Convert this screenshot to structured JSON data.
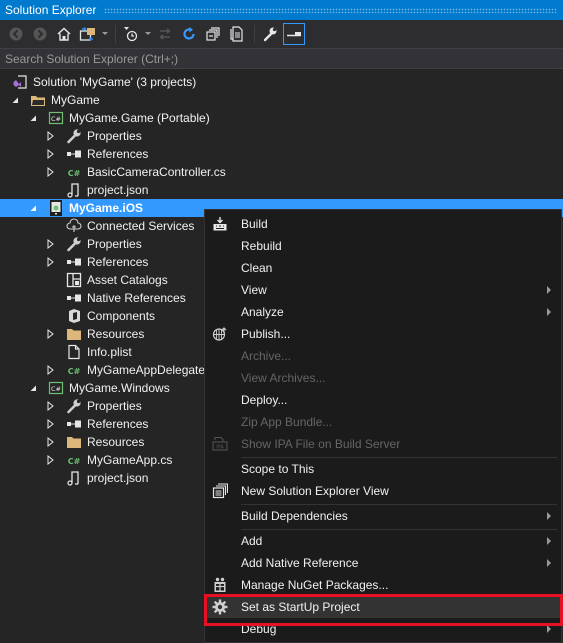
{
  "window": {
    "title": "Solution Explorer"
  },
  "toolbar": {
    "buttons": [
      {
        "name": "back-button",
        "icon": "back-arrow-icon",
        "enabled": false
      },
      {
        "name": "forward-button",
        "icon": "forward-arrow-icon",
        "enabled": false
      },
      {
        "name": "home-button",
        "icon": "home-icon",
        "enabled": true
      },
      {
        "name": "switch-views-button",
        "icon": "switch-views-icon",
        "enabled": true,
        "dropdown": true
      },
      {
        "name": "pending-changes-filter-button",
        "icon": "clock-filter-icon",
        "enabled": true,
        "dropdown": true
      },
      {
        "name": "sync-active-document-button",
        "icon": "sync-icon",
        "enabled": false
      },
      {
        "name": "refresh-button",
        "icon": "refresh-icon",
        "enabled": true
      },
      {
        "name": "collapse-all-button",
        "icon": "collapse-all-icon",
        "enabled": true
      },
      {
        "name": "show-all-files-button",
        "icon": "show-all-files-icon",
        "enabled": true
      },
      {
        "name": "properties-button",
        "icon": "wrench-icon",
        "enabled": true
      },
      {
        "name": "preview-selected-items-button",
        "icon": "preview-icon",
        "enabled": true,
        "active": true
      }
    ]
  },
  "search": {
    "placeholder": "Search Solution Explorer (Ctrl+;)",
    "value": ""
  },
  "tree": {
    "items": [
      {
        "label": "Solution 'MyGame' (3 projects)",
        "icon": "solution-icon",
        "level": 0,
        "expander": "none"
      },
      {
        "label": "MyGame",
        "icon": "solution-folder-icon",
        "level": 0,
        "expander": "expanded"
      },
      {
        "label": "MyGame.Game (Portable)",
        "icon": "csharp-project-icon",
        "level": 1,
        "expander": "expanded"
      },
      {
        "label": "Properties",
        "icon": "wrench-icon",
        "level": 2,
        "expander": "collapsed"
      },
      {
        "label": "References",
        "icon": "references-icon",
        "level": 2,
        "expander": "collapsed"
      },
      {
        "label": "BasicCameraController.cs",
        "icon": "csharp-file-icon",
        "level": 2,
        "expander": "collapsed"
      },
      {
        "label": "project.json",
        "icon": "json-file-icon",
        "level": 2,
        "expander": "none"
      },
      {
        "label": "MyGame.iOS",
        "icon": "ios-project-icon",
        "level": 1,
        "expander": "expanded",
        "selected": true
      },
      {
        "label": "Connected Services",
        "icon": "connected-services-icon",
        "level": 2,
        "expander": "none"
      },
      {
        "label": "Properties",
        "icon": "wrench-icon",
        "level": 2,
        "expander": "collapsed"
      },
      {
        "label": "References",
        "icon": "references-icon",
        "level": 2,
        "expander": "collapsed"
      },
      {
        "label": "Asset Catalogs",
        "icon": "asset-catalog-icon",
        "level": 2,
        "expander": "none"
      },
      {
        "label": "Native References",
        "icon": "references-icon",
        "level": 2,
        "expander": "none"
      },
      {
        "label": "Components",
        "icon": "components-icon",
        "level": 2,
        "expander": "none"
      },
      {
        "label": "Resources",
        "icon": "folder-icon",
        "level": 2,
        "expander": "collapsed"
      },
      {
        "label": "Info.plist",
        "icon": "file-icon",
        "level": 2,
        "expander": "none"
      },
      {
        "label": "MyGameAppDelegate",
        "icon": "csharp-file-icon",
        "level": 2,
        "expander": "collapsed"
      },
      {
        "label": "MyGame.Windows",
        "icon": "csharp-project-icon",
        "level": 1,
        "expander": "expanded"
      },
      {
        "label": "Properties",
        "icon": "wrench-icon",
        "level": 2,
        "expander": "collapsed"
      },
      {
        "label": "References",
        "icon": "references-icon",
        "level": 2,
        "expander": "collapsed"
      },
      {
        "label": "Resources",
        "icon": "folder-icon",
        "level": 2,
        "expander": "collapsed"
      },
      {
        "label": "MyGameApp.cs",
        "icon": "csharp-file-icon",
        "level": 2,
        "expander": "collapsed"
      },
      {
        "label": "project.json",
        "icon": "json-file-icon",
        "level": 2,
        "expander": "none"
      }
    ]
  },
  "context_menu": {
    "items": [
      {
        "label": "Build",
        "icon": "build-icon",
        "enabled": true
      },
      {
        "label": "Rebuild",
        "enabled": true
      },
      {
        "label": "Clean",
        "enabled": true
      },
      {
        "label": "View",
        "enabled": true,
        "submenu": true
      },
      {
        "label": "Analyze",
        "enabled": true,
        "submenu": true
      },
      {
        "label": "Publish...",
        "icon": "publish-icon",
        "enabled": true
      },
      {
        "label": "Archive...",
        "enabled": false
      },
      {
        "label": "View Archives...",
        "enabled": false
      },
      {
        "label": "Deploy...",
        "enabled": true
      },
      {
        "label": "Zip App Bundle...",
        "enabled": false
      },
      {
        "label": "Show IPA File on Build Server",
        "icon": "ipa-icon",
        "enabled": false
      },
      {
        "separator": true
      },
      {
        "label": "Scope to This",
        "enabled": true
      },
      {
        "label": "New Solution Explorer View",
        "icon": "new-solution-explorer-icon",
        "enabled": true
      },
      {
        "separator": true
      },
      {
        "label": "Build Dependencies",
        "enabled": true,
        "submenu": true
      },
      {
        "separator": true
      },
      {
        "label": "Add",
        "enabled": true,
        "submenu": true
      },
      {
        "label": "Add Native Reference",
        "enabled": true,
        "submenu": true
      },
      {
        "label": "Manage NuGet Packages...",
        "icon": "nuget-icon",
        "enabled": true
      },
      {
        "label": "Set as StartUp Project",
        "icon": "gear-icon",
        "enabled": true,
        "hot": true,
        "highlighted": true
      },
      {
        "label": "Debug",
        "enabled": true,
        "submenu": true
      }
    ]
  },
  "colors": {
    "accent": "#007acc",
    "selection": "#3399ff",
    "highlight_box": "#e81123",
    "background": "#252526",
    "menu_background": "#1b1b1c",
    "csharp_green": "#6fbf73",
    "folder": "#dcb67a"
  }
}
